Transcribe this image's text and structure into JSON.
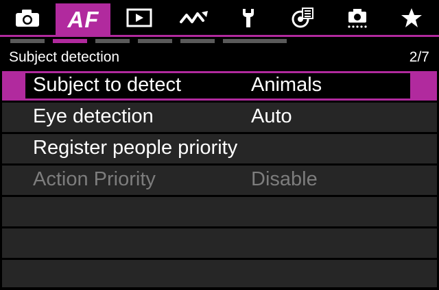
{
  "tabs": [
    {
      "icon": "camera-icon"
    },
    {
      "icon": "af-tab",
      "label": "AF",
      "active": true
    },
    {
      "icon": "playback-icon"
    },
    {
      "icon": "wireless-icon"
    },
    {
      "icon": "wrench-icon"
    },
    {
      "icon": "custom-functions-icon"
    },
    {
      "icon": "camera-settings-icon"
    },
    {
      "icon": "star-icon"
    }
  ],
  "colors": {
    "accent": "#b12a9e",
    "row_bg": "#262626",
    "disabled_text": "#7d7d7d"
  },
  "page_indicator": {
    "count": 6,
    "active_index": 1
  },
  "header": {
    "title": "Subject detection",
    "page": "2/7"
  },
  "menu": {
    "items": [
      {
        "label": "Subject to detect",
        "value": "Animals",
        "selected": true
      },
      {
        "label": "Eye detection",
        "value": "Auto"
      },
      {
        "label": "Register people priority",
        "value": ""
      },
      {
        "label": "Action Priority",
        "value": "Disable",
        "disabled": true
      },
      {
        "label": "",
        "value": ""
      },
      {
        "label": "",
        "value": ""
      },
      {
        "label": "",
        "value": ""
      }
    ]
  }
}
